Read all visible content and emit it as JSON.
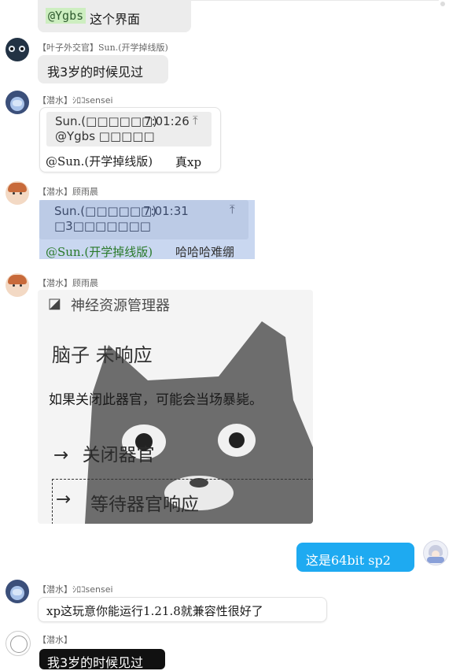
{
  "messages": {
    "m0": {
      "mention": "@Ygbs",
      "text": "这个界面"
    },
    "m1": {
      "sender": "【叶子外交官】Sun.(开学掉线版)",
      "text": "我3岁的时候见过"
    },
    "m2": {
      "sender": "【潜水】ｼﾛｺsensei",
      "quote_author": "Sun.(□□□□□□)",
      "quote_time": "7:01:26",
      "quote_text": "@Ygbs □□□□□",
      "mention": "@Sun.(开学掉线版)",
      "text": "真xp"
    },
    "m3": {
      "sender": "【潜水】顾雨晨",
      "quote_author": "Sun.(□□□□□□)",
      "quote_time": "7:01:31",
      "quote_text": "□3□□□□□□□",
      "mention": "@Sun.(开学掉线版)",
      "text": "哈哈哈难绷"
    },
    "m4": {
      "sender": "【潜水】顾雨晨",
      "dialog_title": "神经资源管理器",
      "dialog_heading": "脑子 未响应",
      "dialog_body": "如果关闭此器官，可能会当场暴毙。",
      "option_close": "关闭器官",
      "option_wait": "等待器官响应",
      "arrow": "→"
    },
    "m5": {
      "text": "这是64bit sp2"
    },
    "m6": {
      "sender": "【潜水】ｼﾛｺsensei",
      "text": "xp这玩意你能运行1.21.8就兼容性很好了"
    },
    "m7": {
      "sender": "【潜水】",
      "text": "我3岁的时候见过"
    }
  },
  "colors": {
    "self_bubble": "#1eaaf1",
    "highlight_bubble": "#c9d7f0",
    "mention_green": "#2a7a2a",
    "dark_bubble": "#111111"
  },
  "icons": {
    "jump": "jump-to-quote-icon",
    "app": "app-icon"
  }
}
